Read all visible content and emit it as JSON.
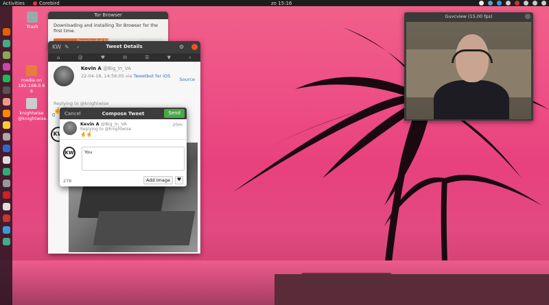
{
  "topbar": {
    "activities": "Activities",
    "app_name": "Corebird",
    "clock": "zo 15:16"
  },
  "desktop_icons": [
    {
      "label": "Trash"
    },
    {
      "label": "media on 192.168.0.6 6"
    },
    {
      "label": "knightwise @knightwise.com"
    }
  ],
  "tor": {
    "title": "Tor Browser",
    "message": "Downloading and installing Tor Browser for the first time.",
    "progress_text": "Downloaded 50.3% (32.4 MiB)",
    "progress": 0.503,
    "accent": "#e2713d"
  },
  "corebird": {
    "title": "Tweet Details",
    "tweet": {
      "name": "Kevin A",
      "handle": "@Big_In_VA",
      "timestamp": "22-04-18, 14:56:05 via",
      "via": "Tweetbot for iOS",
      "source": "Source",
      "replying": "Replying to @knightwise",
      "emoji": "🤞🤞"
    },
    "counter": "0",
    "avatar_text": "KW"
  },
  "compose": {
    "cancel": "Cancel",
    "title": "Compose Tweet",
    "send": "Send",
    "reply_name": "Kevin A",
    "reply_handle": "@Big_In_VA",
    "reply_time": "20m",
    "reply_to": "Replying to @knightwise",
    "reply_emoji": "🤞🤞",
    "avatar_text": "KW",
    "text": "You",
    "char_count": "276",
    "add_image": "Add Image",
    "send_color": "#4aa845"
  },
  "guvcview": {
    "title": "Guvcview  (15.00 fps)"
  }
}
